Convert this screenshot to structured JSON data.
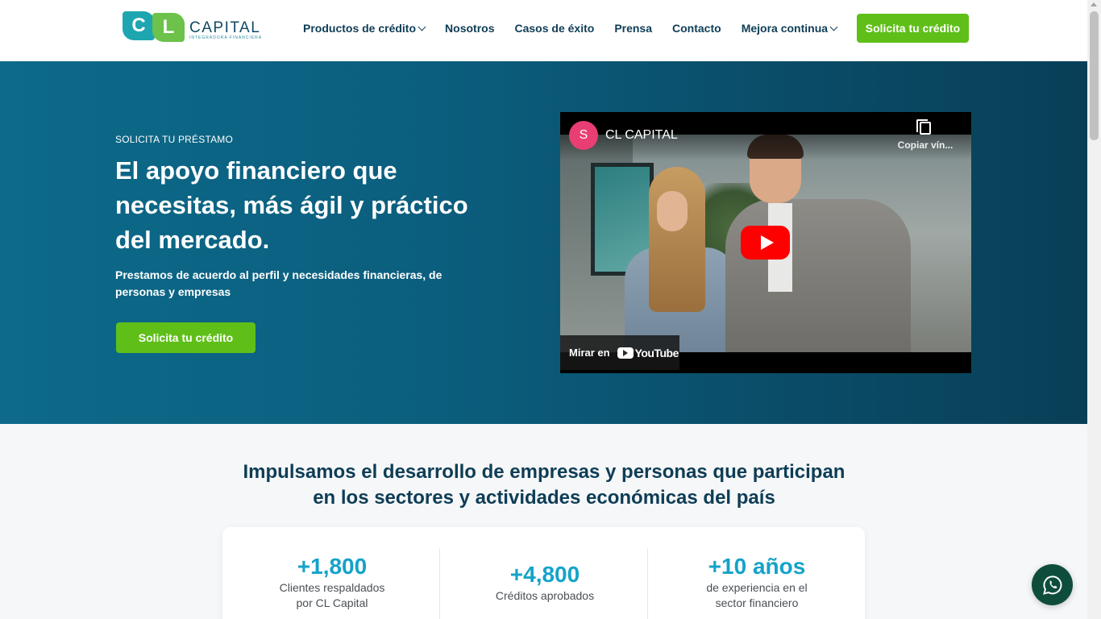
{
  "header": {
    "logo": {
      "mark_c": "C",
      "mark_l": "L",
      "name": "CAPITAL",
      "tagline": "Integradora Financiera"
    },
    "nav": [
      {
        "label": "Productos de crédito",
        "has_dropdown": true
      },
      {
        "label": "Nosotros",
        "has_dropdown": false
      },
      {
        "label": "Casos de éxito",
        "has_dropdown": false
      },
      {
        "label": "Prensa",
        "has_dropdown": false
      },
      {
        "label": "Contacto",
        "has_dropdown": false
      },
      {
        "label": "Mejora continua",
        "has_dropdown": true
      }
    ],
    "cta_label": "Solicita tu crédito"
  },
  "hero": {
    "eyebrow": "SOLICITA TU PRÉSTAMO",
    "title": "El apoyo financiero que necesitas, más ágil y práctico del mercado.",
    "subtitle": "Prestamos de acuerdo al perfil y necesidades financieras, de personas y empresas",
    "cta_label": "Solicita tu crédito"
  },
  "video": {
    "channel_initial": "S",
    "title": "CL CAPITAL",
    "copy_label": "Copiar vín...",
    "watch_on": "Mirar en",
    "platform": "YouTube"
  },
  "stats": {
    "heading": "Impulsamos el desarrollo de empresas y personas que participan en los sectores y actividades económicas del país",
    "items": [
      {
        "value": "+1,800",
        "label_line1": "Clientes respaldados",
        "label_line2": "por CL Capital"
      },
      {
        "value": "+4,800",
        "label_line1": "Créditos aprobados",
        "label_line2": ""
      },
      {
        "value": "+10 años",
        "label_line1": "de experiencia en el",
        "label_line2": "sector financiero"
      }
    ]
  },
  "colors": {
    "brand_green": "#5fbf18",
    "brand_teal": "#1ea6b0",
    "navy": "#0e3d56",
    "stat_blue": "#14a3c9",
    "hero_bg": "#0b5e7e",
    "youtube_red": "#ff0000",
    "whatsapp_bg": "#0e4d3c"
  },
  "icons": {
    "dropdown": "chevron-down-icon",
    "play": "play-icon",
    "copy": "copy-link-icon",
    "whatsapp": "whatsapp-icon"
  }
}
